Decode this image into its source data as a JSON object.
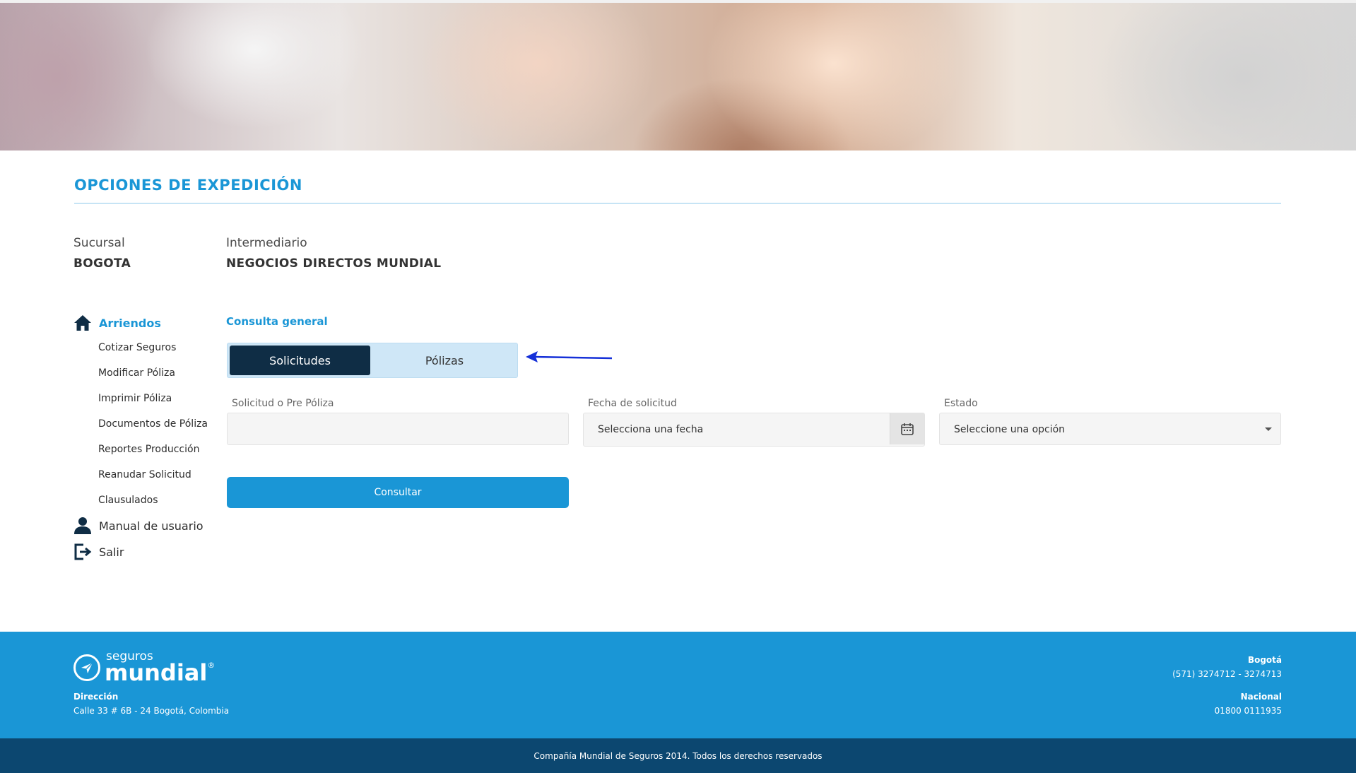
{
  "section": {
    "title": "OPCIONES DE EXPEDICIÓN"
  },
  "info": {
    "branch_label": "Sucursal",
    "branch_value": "BOGOTA",
    "intermediary_label": "Intermediario",
    "intermediary_value": "NEGOCIOS DIRECTOS MUNDIAL"
  },
  "sidebar": {
    "head": {
      "label": "Arriendos",
      "icon": "home-icon"
    },
    "items": [
      {
        "label": "Cotizar Seguros"
      },
      {
        "label": "Modificar Póliza"
      },
      {
        "label": "Imprimir Póliza"
      },
      {
        "label": "Documentos de Póliza"
      },
      {
        "label": "Reportes Producción"
      },
      {
        "label": "Reanudar Solicitud"
      },
      {
        "label": "Clausulados"
      }
    ],
    "manual": {
      "label": "Manual de usuario",
      "icon": "user-icon"
    },
    "logout": {
      "label": "Salir",
      "icon": "logout-icon"
    }
  },
  "consulta": {
    "title": "Consulta general",
    "tabs": [
      {
        "label": "Solicitudes",
        "active": true
      },
      {
        "label": "Pólizas",
        "active": false
      }
    ],
    "fields": {
      "solicitud_label": "Solicitud o Pre Póliza",
      "solicitud_value": "",
      "fecha_label": "Fecha de solicitud",
      "fecha_placeholder": "Selecciona una fecha",
      "estado_label": "Estado",
      "estado_value": "Seleccione una opción"
    },
    "submit_label": "Consultar"
  },
  "footer": {
    "logo_small": "seguros",
    "logo_big": "mundial",
    "logo_reg": "®",
    "address_label": "Dirección",
    "address_value": "Calle 33 # 6B - 24 Bogotá, Colombia",
    "city_label": "Bogotá",
    "city_phones": "(571) 3274712 - 3274713",
    "national_label": "Nacional",
    "national_phone": "01800 0111935",
    "copyright": "Compañía Mundial de Seguros 2014. Todos los derechos reservados"
  },
  "colors": {
    "accent": "#1a96d6",
    "dark_navy": "#0f2d45",
    "bottom_bar": "#0c4770",
    "arrow": "#1530d8"
  }
}
